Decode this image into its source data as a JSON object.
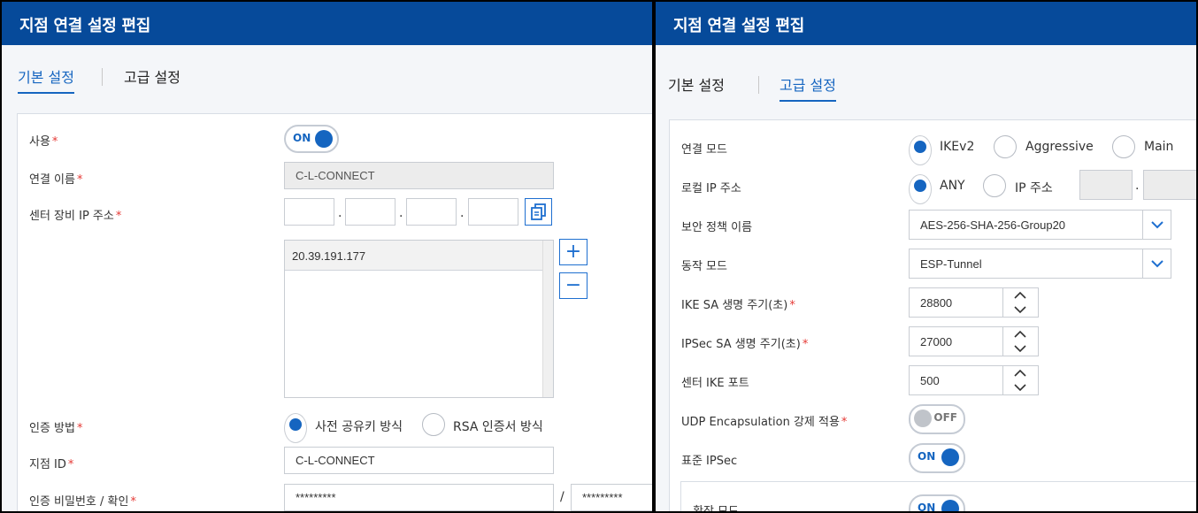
{
  "left_panel": {
    "title": "지점 연결 설정 편집",
    "tabs": [
      "기본 설정",
      "고급 설정"
    ],
    "active_tab": "기본 설정",
    "fields": {
      "use": {
        "label": "사용",
        "required": "*",
        "toggle": "ON"
      },
      "connection_name": {
        "label": "연결 이름",
        "required": "*",
        "value": "C-L-CONNECT"
      },
      "center_ip": {
        "label": "센터 장비 IP 주소",
        "required": "*",
        "octets": [
          "",
          "",
          "",
          ""
        ],
        "list": [
          "20.39.191.177"
        ]
      },
      "auth_method": {
        "label": "인증 방법",
        "required": "*",
        "options": [
          "사전 공유키 방식",
          "RSA 인증서 방식"
        ],
        "selected": "사전 공유키 방식"
      },
      "branch_id": {
        "label": "지점 ID",
        "required": "*",
        "value": "C-L-CONNECT"
      },
      "auth_password": {
        "label": "인증 비밀번호 / 확인",
        "required": "*",
        "value": "*********",
        "confirm": "*********",
        "separator": "/"
      }
    }
  },
  "right_panel": {
    "title": "지점 연결 설정 편집",
    "tabs": [
      "기본 설정",
      "고급 설정"
    ],
    "active_tab": "고급 설정",
    "fields": {
      "connection_mode": {
        "label": "연결 모드",
        "options": [
          "IKEv2",
          "Aggressive",
          "Main"
        ],
        "selected": "IKEv2"
      },
      "local_ip": {
        "label": "로컬 IP 주소",
        "options": [
          "ANY",
          "IP 주소"
        ],
        "selected": "ANY",
        "dot": "."
      },
      "security_policy": {
        "label": "보안 정책 이름",
        "value": "AES-256-SHA-256-Group20"
      },
      "operation_mode": {
        "label": "동작 모드",
        "value": "ESP-Tunnel"
      },
      "ike_sa_lifetime": {
        "label": "IKE SA 생명 주기(초)",
        "required": "*",
        "value": "28800"
      },
      "ipsec_sa_lifetime": {
        "label": "IPSec SA 생명 주기(초)",
        "required": "*",
        "value": "27000"
      },
      "center_ike_port": {
        "label": "센터 IKE 포트",
        "value": "500"
      },
      "udp_encap": {
        "label": "UDP Encapsulation 강제 적용",
        "required": "*",
        "toggle": "OFF"
      },
      "std_ipsec": {
        "label": "표준 IPSec",
        "toggle": "ON"
      },
      "ext_mode": {
        "label": "확장 모드",
        "toggle": "ON"
      }
    }
  },
  "colors": {
    "header": "#064a9a",
    "accent": "#1565c0",
    "required": "#e53935"
  },
  "icons": [
    "copy-icon",
    "plus-icon",
    "minus-icon",
    "chevron-down-icon",
    "spinner-up-icon",
    "spinner-down-icon"
  ]
}
